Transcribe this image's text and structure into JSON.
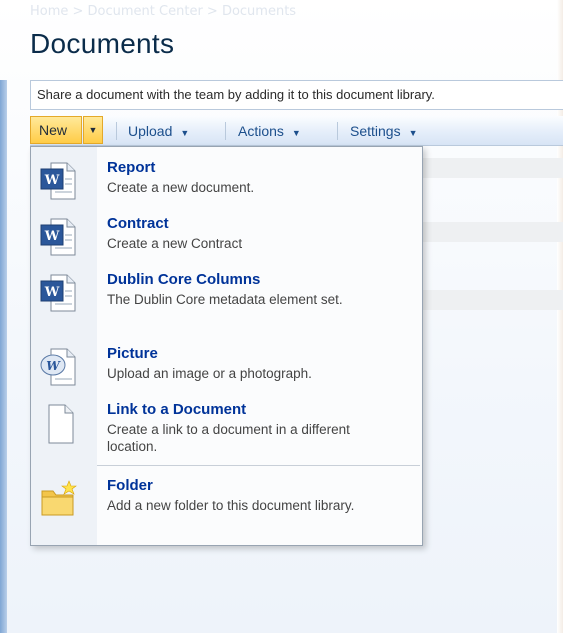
{
  "breadcrumb": "Home > Document Center > Documents",
  "page_title": "Documents",
  "description": "Share a document with the team by adding it to this document library.",
  "toolbar": {
    "new_label": "New",
    "upload_label": "Upload",
    "actions_label": "Actions",
    "settings_label": "Settings"
  },
  "new_menu": {
    "items": [
      {
        "title": "Report",
        "description": "Create a new document.",
        "icon": "word-document-icon"
      },
      {
        "title": "Contract",
        "description": "Create a new Contract",
        "icon": "word-document-icon"
      },
      {
        "title": "Dublin Core Columns",
        "description": "The Dublin Core metadata element set.",
        "icon": "word-document-icon"
      },
      {
        "title": "Picture",
        "description": "Upload an image or a photograph.",
        "icon": "word-picture-document-icon"
      },
      {
        "title": "Link to a Document",
        "description": "Create a link to a document in a different location.",
        "icon": "blank-page-icon"
      },
      {
        "title": "Folder",
        "description": "Add a new folder to this document library.",
        "icon": "new-folder-icon"
      }
    ]
  },
  "colors": {
    "title": "#0b2c4a",
    "link": "#003399",
    "new_button": "#ffcc47",
    "toolbar_text": "#1c4f8c"
  }
}
